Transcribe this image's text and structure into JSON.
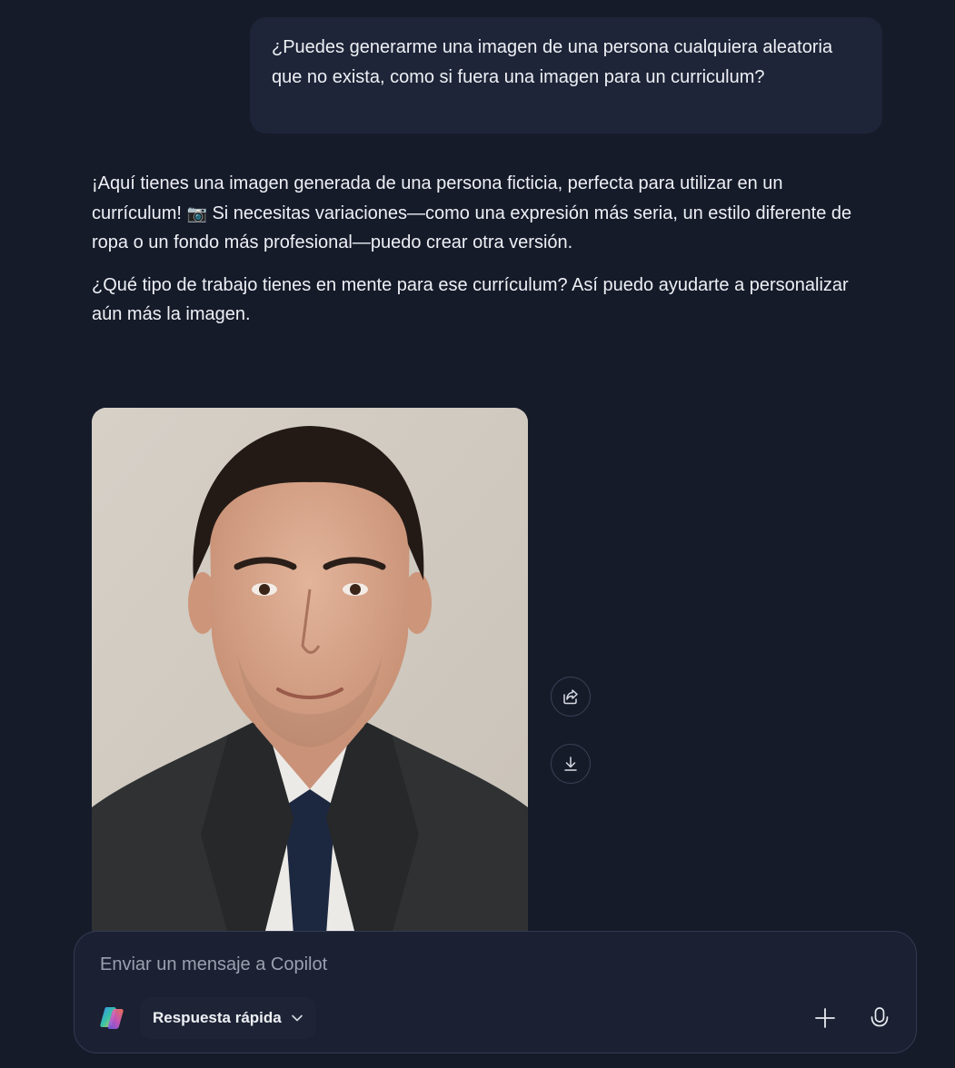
{
  "conversation": {
    "user_message": "¿Puedes generarme una imagen de una persona cualquiera aleatoria que no exista, como si fuera una imagen para un curriculum?",
    "assistant_paragraph_1_a": "¡Aquí tienes una imagen generada de una persona ficticia, perfecta para utilizar en un currículum!",
    "assistant_paragraph_1_emoji": "📷",
    "assistant_paragraph_1_b": "Si necesitas variaciones—como una expresión más seria, un estilo diferente de ropa o un fondo más profesional—puedo crear otra versión.",
    "assistant_paragraph_2": "¿Qué tipo de trabajo tienes en mente para ese currículum? Así puedo ayudarte a personalizar aún más la imagen."
  },
  "image_actions": {
    "share_icon": "share-icon",
    "download_icon": "download-icon"
  },
  "composer": {
    "placeholder": "Enviar un mensaje a Copilot",
    "value": "",
    "mode_label": "Respuesta rápida",
    "mode_icon": "chevron-down-icon",
    "add_icon": "plus-icon",
    "mic_icon": "microphone-icon"
  },
  "colors": {
    "background": "#161b2a",
    "user_bubble": "#1e2538",
    "composer": "#1b2133",
    "text": "#eef0f5",
    "placeholder": "#9aa0ae"
  }
}
